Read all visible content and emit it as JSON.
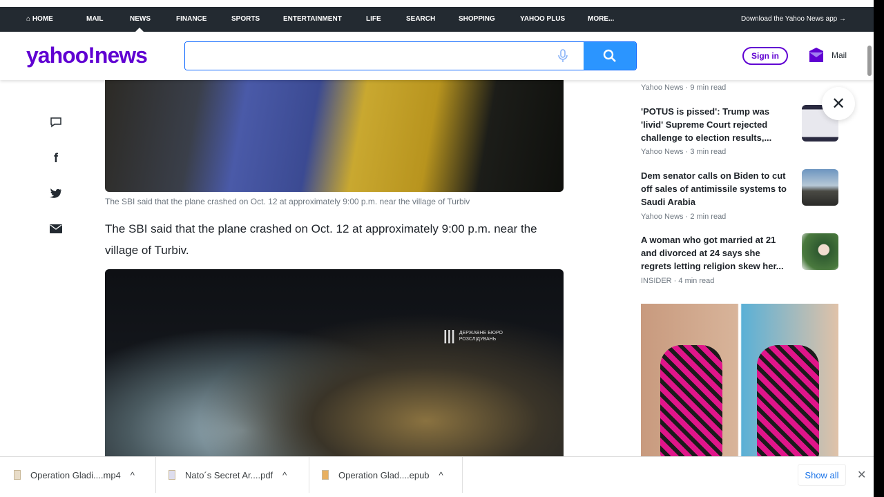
{
  "nav": {
    "items": [
      "HOME",
      "MAIL",
      "NEWS",
      "FINANCE",
      "SPORTS",
      "ENTERTAINMENT",
      "LIFE",
      "SEARCH",
      "SHOPPING",
      "YAHOO PLUS",
      "MORE..."
    ],
    "app_link": "Download the Yahoo News app →"
  },
  "header": {
    "logo": "yahoo!news",
    "search_value": "",
    "sign_in": "Sign in",
    "mail": "Mail"
  },
  "article": {
    "caption": "The SBI said that the plane crashed on Oct. 12 at approximately 9:00 p.m. near the village of Turbiv",
    "paragraph": "The SBI said that the plane crashed on Oct. 12 at approximately 9:00 p.m. near the village of Turbiv.",
    "watermark": "ДЕРЖАВНЕ БЮРО РОЗСЛІДУВАНЬ"
  },
  "sidebar": {
    "prev_meta": "Yahoo News · 9 min read",
    "stories": [
      {
        "title": "'POTUS is pissed': Trump was 'livid' Supreme Court rejected challenge to election results,...",
        "meta": "Yahoo News · 3 min read"
      },
      {
        "title": "Dem senator calls on Biden to cut off sales of antimissile systems to Saudi Arabia",
        "meta": "Yahoo News · 2 min read"
      },
      {
        "title": "A woman who got married at 21 and divorced at 24 says she regrets letting religion skew her...",
        "meta": "INSIDER · 4 min read"
      }
    ]
  },
  "downloads": {
    "items": [
      "Operation Gladi....mp4",
      "Nato´s Secret Ar....pdf",
      "Operation Glad....epub"
    ],
    "show_all": "Show all"
  },
  "colors": {
    "brand": "#6001d2",
    "nav_bg": "#232a31",
    "search_btn": "#2b95ff"
  }
}
